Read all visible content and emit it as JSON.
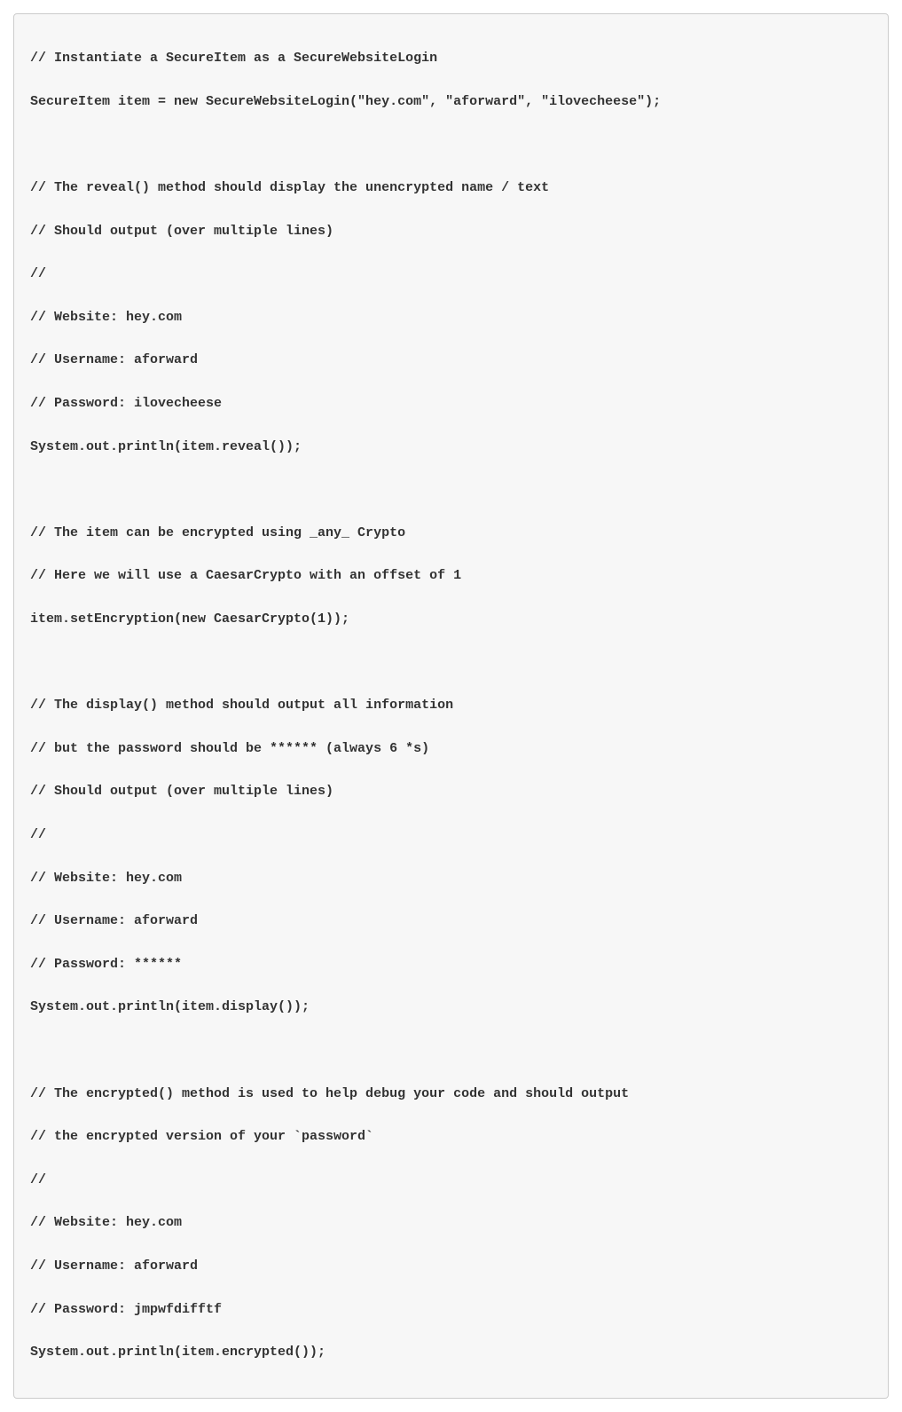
{
  "code": {
    "lines": [
      "// Instantiate a SecureItem as a SecureWebsiteLogin",
      "SecureItem item = new SecureWebsiteLogin(\"hey.com\", \"aforward\", \"ilovecheese\");",
      "",
      "// The reveal() method should display the unencrypted name / text",
      "// Should output (over multiple lines)",
      "//",
      "// Website: hey.com",
      "// Username: aforward",
      "// Password: ilovecheese",
      "System.out.println(item.reveal());",
      "",
      "// The item can be encrypted using _any_ Crypto",
      "// Here we will use a CaesarCrypto with an offset of 1",
      "item.setEncryption(new CaesarCrypto(1));",
      "",
      "// The display() method should output all information",
      "// but the password should be ****** (always 6 *s)",
      "// Should output (over multiple lines)",
      "//",
      "// Website: hey.com",
      "// Username: aforward",
      "// Password: ******",
      "System.out.println(item.display());",
      "",
      "// The encrypted() method is used to help debug your code and should output",
      "// the encrypted version of your `password`",
      "//",
      "// Website: hey.com",
      "// Username: aforward",
      "// Password: jmpwfdifftf",
      "System.out.println(item.encrypted());"
    ]
  }
}
